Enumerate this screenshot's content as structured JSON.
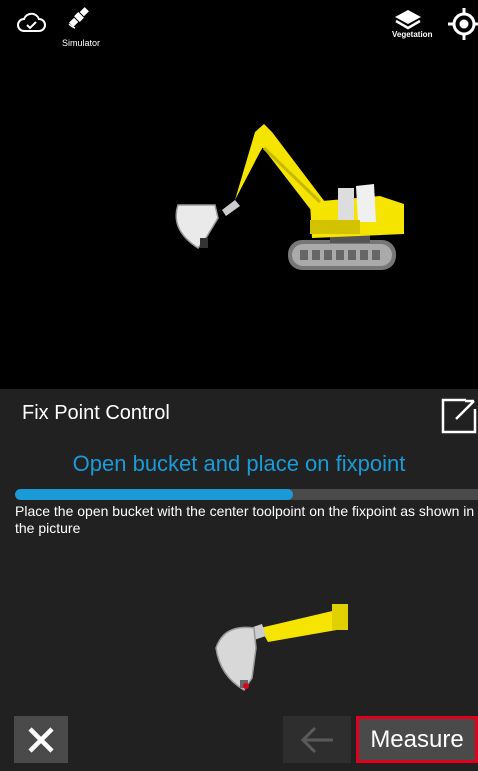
{
  "topbar": {
    "cloud_icon": "cloud-check-icon",
    "satellite_icon": "satellite-icon",
    "gnss_label": "Simulator",
    "layers_icon": "layers-icon",
    "layers_label": "Vegetation",
    "locate_icon": "crosshair-icon"
  },
  "panel": {
    "title": "Fix Point Control",
    "expand_icon": "expand-icon",
    "step_title": "Open bucket and place on fixpoint",
    "progress": 0.6,
    "instruction": "Place the open bucket with the center toolpoint on the fixpoint as shown in the picture"
  },
  "footer": {
    "close_icon": "close-icon",
    "back_icon": "arrow-left-icon",
    "measure_label": "Measure"
  },
  "colors": {
    "accent": "#1a9bd7",
    "highlight": "#e0001b",
    "excavator": "#f4e400"
  }
}
